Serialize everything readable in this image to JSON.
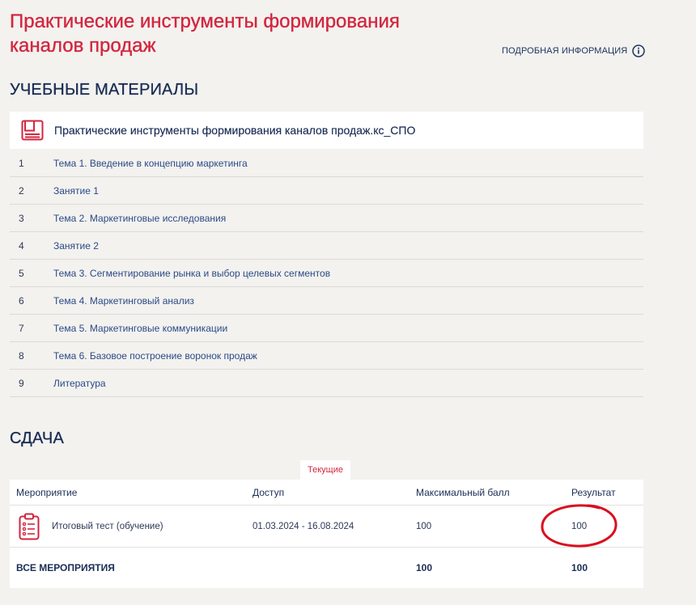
{
  "header": {
    "title": "Практические инструменты формирования каналов продаж",
    "more_info_label": "ПОДРОБНАЯ ИНФОРМАЦИЯ",
    "more_info_icon": "info-circle-icon"
  },
  "materials": {
    "heading": "УЧЕБНЫЕ МАТЕРИАЛЫ",
    "course_icon": "book-icon",
    "course_name": "Практические инструменты формирования каналов продаж.кс_СПО",
    "items": [
      {
        "num": "1",
        "label": "Тема 1. Введение в концепцию маркетинга"
      },
      {
        "num": "2",
        "label": "Занятие 1"
      },
      {
        "num": "3",
        "label": "Тема 2. Маркетинговые исследования"
      },
      {
        "num": "4",
        "label": "Занятие 2"
      },
      {
        "num": "5",
        "label": "Тема 3. Сегментирование рынка и выбор целевых сегментов"
      },
      {
        "num": "6",
        "label": "Тема 4. Маркетинговый анализ"
      },
      {
        "num": "7",
        "label": "Тема 5. Маркетинговые коммуникации"
      },
      {
        "num": "8",
        "label": "Тема 6. Базовое построение воронок продаж"
      },
      {
        "num": "9",
        "label": "Литература"
      }
    ]
  },
  "submission": {
    "heading": "СДАЧА",
    "tab_current": "Текущие",
    "columns": {
      "event": "Мероприятие",
      "access": "Доступ",
      "max_score": "Максимальный балл",
      "result": "Результат"
    },
    "rows": [
      {
        "icon": "clipboard-list-icon",
        "event": "Итоговый тест (обучение)",
        "access": "01.03.2024 - 16.08.2024",
        "max_score": "100",
        "result": "100"
      }
    ],
    "total": {
      "label": "ВСЕ МЕРОПРИЯТИЯ",
      "max_score": "100",
      "result": "100"
    }
  },
  "colors": {
    "accent_red": "#d3263f",
    "navy": "#1a2d55",
    "link_blue": "#2b4a86",
    "background": "#f3f2ef"
  }
}
